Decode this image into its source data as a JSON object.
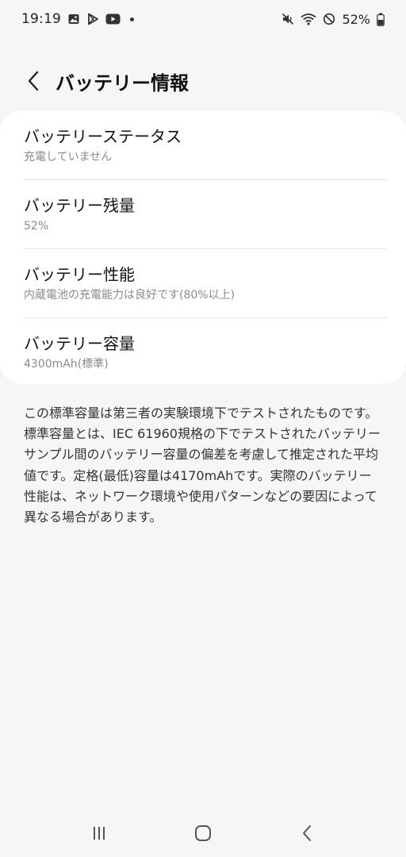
{
  "status_bar": {
    "time": "19:19",
    "battery_percent": "52%",
    "left_icons": [
      "gallery-icon",
      "play-store-icon",
      "youtube-icon",
      "notification-dot"
    ],
    "right_icons": [
      "mute-icon",
      "wifi-icon",
      "do-not-disturb-icon",
      "battery-icon"
    ]
  },
  "header": {
    "title": "バッテリー情報"
  },
  "items": [
    {
      "title": "バッテリーステータス",
      "subtitle": "充電していません"
    },
    {
      "title": "バッテリー残量",
      "subtitle": "52%"
    },
    {
      "title": "バッテリー性能",
      "subtitle": "内蔵電池の充電能力は良好です(80%以上)"
    },
    {
      "title": "バッテリー容量",
      "subtitle": "4300mAh(標準)"
    }
  ],
  "description": "この標準容量は第三者の実験環境下でテストされたものです。標準容量とは、IEC 61960規格の下でテストされたバッテリーサンプル間のバッテリー容量の偏差を考慮して推定された平均値です。定格(最低)容量は4170mAhです。実際のバッテリー性能は、ネットワーク環境や使用パターンなどの要因によって異なる場合があります。",
  "colors": {
    "background": "#f6f6f6",
    "card": "#ffffff",
    "subtitle": "#8a8a8a"
  }
}
